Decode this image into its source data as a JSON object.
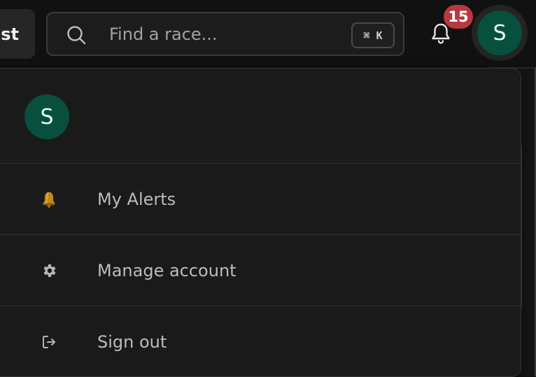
{
  "header": {
    "partial_button_label": "st",
    "search": {
      "placeholder": "Find a race...",
      "value": "",
      "shortcut": "⌘ K"
    },
    "notifications": {
      "count": "15",
      "icon": "bell-icon",
      "badge_color": "#b8383f"
    },
    "user": {
      "initial": "S",
      "avatar_color": "#07503d"
    }
  },
  "menu": {
    "avatar_initial": "S",
    "items": [
      {
        "label": "My Alerts",
        "icon": "bell-emoji-icon"
      },
      {
        "label": "Manage account",
        "icon": "gear-icon"
      },
      {
        "label": "Sign out",
        "icon": "sign-out-icon"
      }
    ]
  }
}
